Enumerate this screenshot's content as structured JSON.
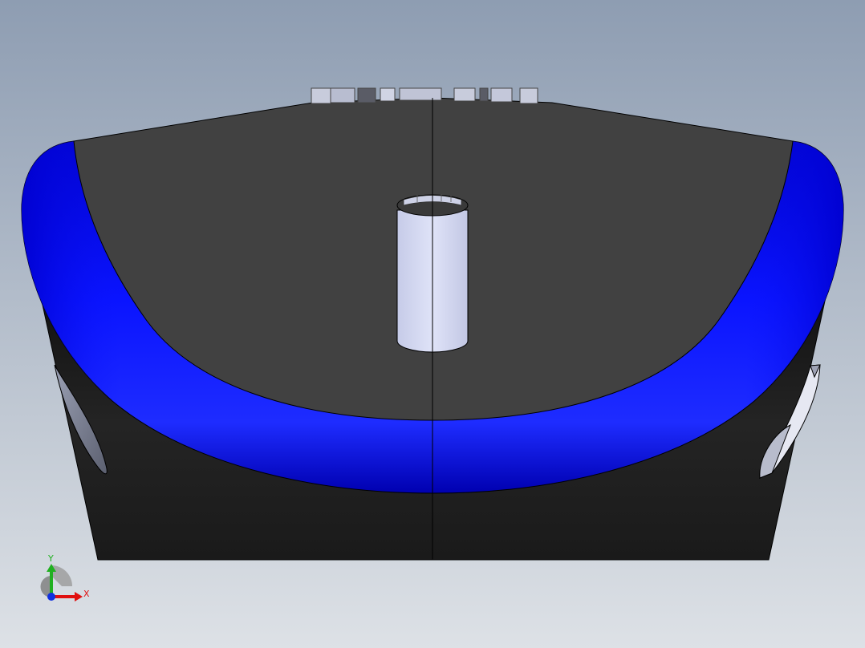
{
  "viewport": {
    "background_top": "#8e9db2",
    "background_bottom": "#dde1e6"
  },
  "model": {
    "body_top_color": "#414141",
    "body_lower_color": "#1c1c1c",
    "trim_color": "#0a19ff",
    "hole_color": "#d7dcf5",
    "edge_color": "#000000"
  },
  "triad": {
    "x_label": "X",
    "y_label": "Y",
    "x_color": "#e01010",
    "y_color": "#20b020",
    "z_color": "#1030e0"
  }
}
